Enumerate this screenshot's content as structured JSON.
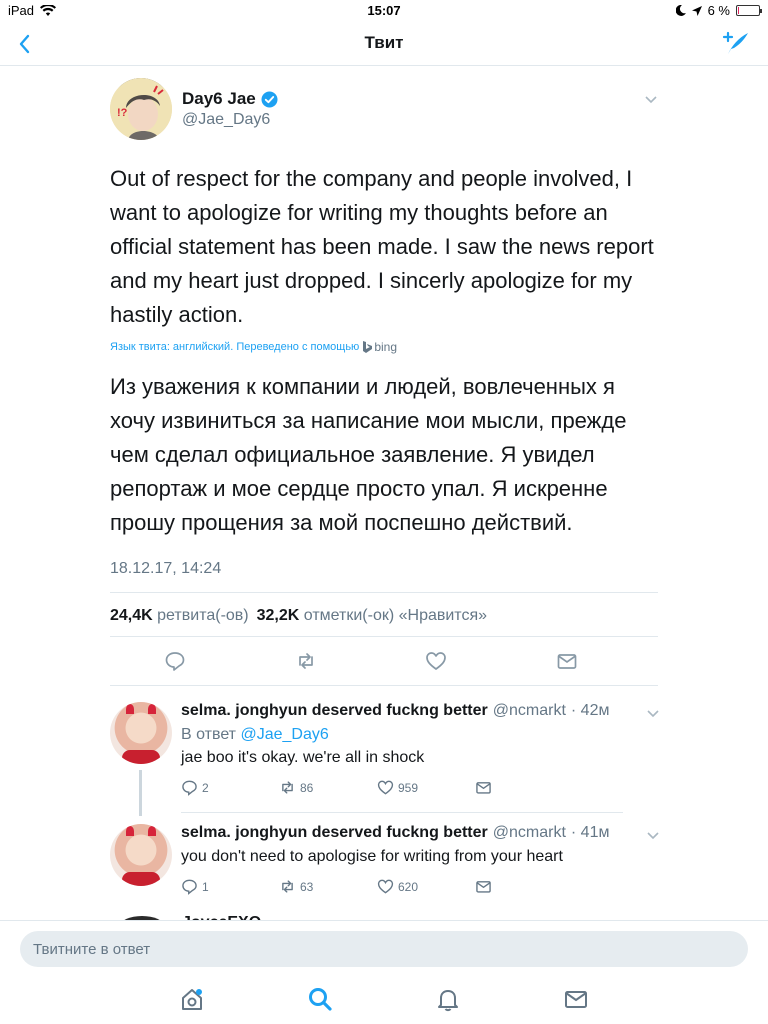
{
  "status_bar": {
    "device": "iPad",
    "time": "15:07",
    "battery": "6 %",
    "battery_level": 0.06
  },
  "nav": {
    "title": "Твит",
    "back_icon": "chevron-left-icon",
    "compose_icon": "compose-tweet-icon"
  },
  "tweet": {
    "author_name": "Day6 Jae",
    "author_handle": "@Jae_Day6",
    "text": "Out of respect for the company and people involved, I want to apologize for writing my thoughts before an official statement has been made. I saw the news report and my heart just dropped. I sincerly apologize for my hastily action.",
    "translation_note": "Язык твита: английский. Переведено с помощью",
    "translator": "bing",
    "translated_text": "Из уважения к компании и людей, вовлеченных я хочу извиниться за написание мои мысли, прежде чем сделал официальное заявление. Я увидел репортаж и мое сердце просто упал. Я искренне прошу прощения за мой поспешно действий.",
    "timestamp": "18.12.17, 14:24",
    "retweets_count": "24,4K",
    "retweets_label": "ретвита(-ов)",
    "likes_count": "32,2K",
    "likes_label": "отметки(-ок) «Нравится»"
  },
  "replies": [
    {
      "name": "selma. jonghyun deserved fuckng better",
      "handle": "@ncmarkt",
      "time": "· 42м",
      "reply_to_prefix": "В ответ",
      "reply_to_handle": "@Jae_Day6",
      "text": "jae boo it's okay. we're all in shock",
      "replies": "2",
      "retweets": "86",
      "likes": "959"
    },
    {
      "name": "selma. jonghyun deserved fuckng better",
      "handle": "@ncmarkt",
      "time": "· 41м",
      "text": "you don't need to apologise for writing from your heart",
      "replies": "1",
      "retweets": "63",
      "likes": "620"
    }
  ],
  "partial_reply": {
    "name": "JoyceEXO"
  },
  "composer": {
    "placeholder": "Твитните в ответ"
  },
  "colors": {
    "accent": "#1da1f2",
    "secondary_text": "#657786",
    "divider": "#e1e8ed"
  }
}
